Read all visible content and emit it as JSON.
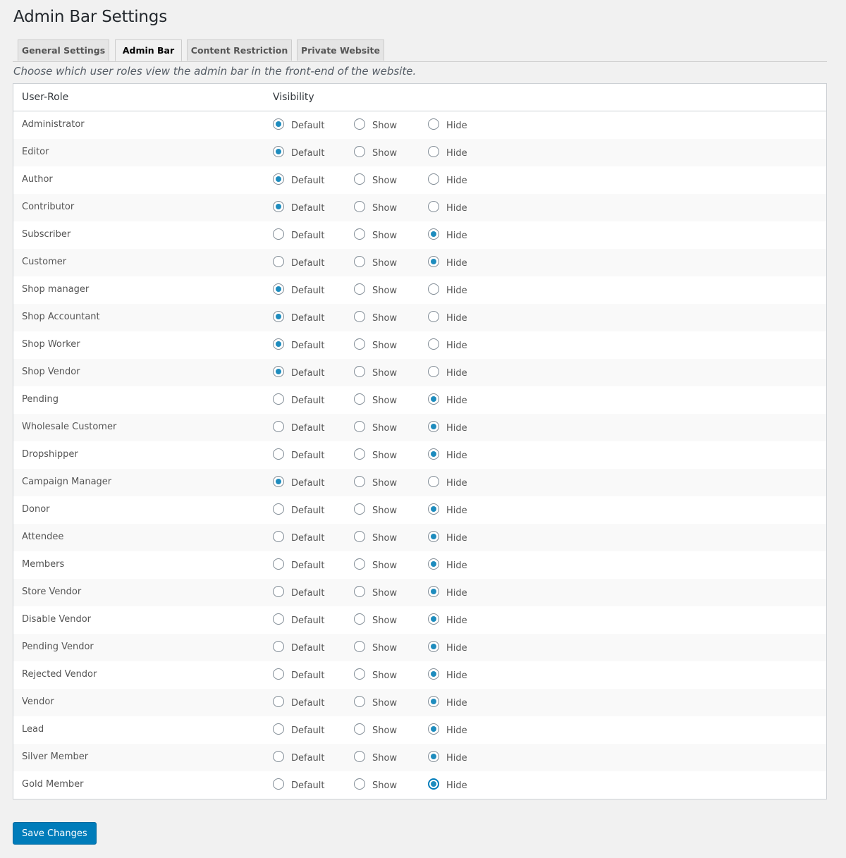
{
  "page": {
    "title": "Admin Bar Settings",
    "description": "Choose which user roles view the admin bar in the front-end of the website."
  },
  "tabs": [
    {
      "label": "General Settings",
      "active": false
    },
    {
      "label": "Admin Bar",
      "active": true
    },
    {
      "label": "Content Restriction",
      "active": false
    },
    {
      "label": "Private Website",
      "active": false
    }
  ],
  "table": {
    "headers": {
      "role": "User-Role",
      "visibility": "Visibility"
    },
    "options": [
      "Default",
      "Show",
      "Hide"
    ],
    "rows": [
      {
        "role": "Administrator",
        "value": "Default"
      },
      {
        "role": "Editor",
        "value": "Default"
      },
      {
        "role": "Author",
        "value": "Default"
      },
      {
        "role": "Contributor",
        "value": "Default"
      },
      {
        "role": "Subscriber",
        "value": "Hide"
      },
      {
        "role": "Customer",
        "value": "Hide"
      },
      {
        "role": "Shop manager",
        "value": "Default"
      },
      {
        "role": "Shop Accountant",
        "value": "Default"
      },
      {
        "role": "Shop Worker",
        "value": "Default"
      },
      {
        "role": "Shop Vendor",
        "value": "Default"
      },
      {
        "role": "Pending",
        "value": "Hide"
      },
      {
        "role": "Wholesale Customer",
        "value": "Hide"
      },
      {
        "role": "Dropshipper",
        "value": "Hide"
      },
      {
        "role": "Campaign Manager",
        "value": "Default"
      },
      {
        "role": "Donor",
        "value": "Hide"
      },
      {
        "role": "Attendee",
        "value": "Hide"
      },
      {
        "role": "Members",
        "value": "Hide"
      },
      {
        "role": "Store Vendor",
        "value": "Hide"
      },
      {
        "role": "Disable Vendor",
        "value": "Hide"
      },
      {
        "role": "Pending Vendor",
        "value": "Hide"
      },
      {
        "role": "Rejected Vendor",
        "value": "Hide"
      },
      {
        "role": "Vendor",
        "value": "Hide"
      },
      {
        "role": "Lead",
        "value": "Hide"
      },
      {
        "role": "Silver Member",
        "value": "Hide"
      },
      {
        "role": "Gold Member",
        "value": "Hide",
        "focused": true
      }
    ]
  },
  "actions": {
    "save_label": "Save Changes"
  },
  "colors": {
    "accent": "#007cba",
    "radio_dot": "#1e8cbe"
  }
}
